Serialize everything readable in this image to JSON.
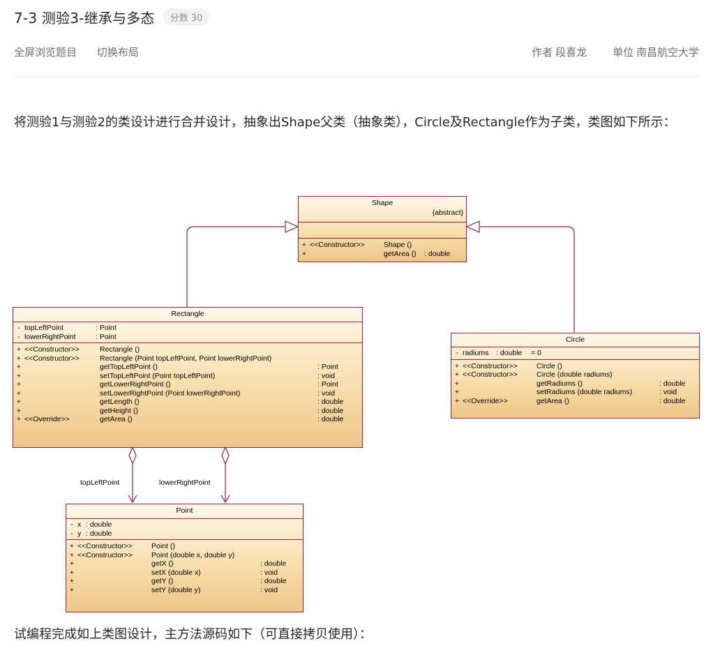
{
  "header": {
    "title": "7-3 测验3-继承与多态",
    "score": "分数 30",
    "actions": [
      "全屏浏览题目",
      "切换布局"
    ],
    "author_label": "作者",
    "author": "段喜龙",
    "unit_label": "单位",
    "unit": "南昌航空大学"
  },
  "description": "将测验1与测验2的类设计进行合并设计，抽象出Shape父类（抽象类），Circle及Rectangle作为子类，类图如下所示：",
  "footer_text": "试编程完成如上类图设计，主方法源码如下（可直接拷贝使用）：",
  "diagram": {
    "shape": {
      "name": "Shape",
      "stereotype": "{abstract}",
      "ops": [
        {
          "vis": "+",
          "st": "<<Constructor>>",
          "name": "Shape ()",
          "type": ""
        },
        {
          "vis": "+",
          "st": "",
          "name": "getArea ()",
          "type": ": double"
        }
      ]
    },
    "rectangle": {
      "name": "Rectangle",
      "attrs": [
        {
          "vis": "-",
          "name": "topLeftPoint",
          "type": ": Point"
        },
        {
          "vis": "-",
          "name": "lowerRightPoint",
          "type": ": Point"
        }
      ],
      "ops": [
        {
          "vis": "+",
          "st": "<<Constructor>>",
          "name": "Rectangle ()",
          "type": ""
        },
        {
          "vis": "+",
          "st": "<<Constructor>>",
          "name": "Rectangle (Point topLeftPoint, Point lowerRightPoint)",
          "type": ""
        },
        {
          "vis": "+",
          "st": "",
          "name": "getTopLeftPoint ()",
          "type": ": Point"
        },
        {
          "vis": "+",
          "st": "",
          "name": "setTopLeftPoint (Point topLeftPoint)",
          "type": ": void"
        },
        {
          "vis": "+",
          "st": "",
          "name": "getLowerRightPoint ()",
          "type": ": Point"
        },
        {
          "vis": "+",
          "st": "",
          "name": "setLowerRightPoint (Point lowerRightPoint)",
          "type": ": void"
        },
        {
          "vis": "+",
          "st": "",
          "name": "getLength ()",
          "type": ": double"
        },
        {
          "vis": "+",
          "st": "",
          "name": "getHeight ()",
          "type": ": double"
        },
        {
          "vis": "+",
          "st": "<<Override>>",
          "name": "getArea ()",
          "type": ": double"
        }
      ]
    },
    "circle": {
      "name": "Circle",
      "attrs": [
        {
          "vis": "-",
          "name": "radiums",
          "type": ": double",
          "init": "= 0"
        }
      ],
      "ops": [
        {
          "vis": "+",
          "st": "<<Constructor>>",
          "name": "Circle ()",
          "type": ""
        },
        {
          "vis": "+",
          "st": "<<Constructor>>",
          "name": "Circle (double radiums)",
          "type": ""
        },
        {
          "vis": "+",
          "st": "",
          "name": "getRadiums ()",
          "type": ": double"
        },
        {
          "vis": "+",
          "st": "",
          "name": "setRadiums (double radiums)",
          "type": ": void"
        },
        {
          "vis": "+",
          "st": "<<Override>>",
          "name": "getArea ()",
          "type": ": double"
        }
      ]
    },
    "point": {
      "name": "Point",
      "attrs": [
        {
          "vis": "-",
          "name": "x",
          "type": ": double"
        },
        {
          "vis": "-",
          "name": "y",
          "type": ": double"
        }
      ],
      "ops": [
        {
          "vis": "+",
          "st": "<<Constructor>>",
          "name": "Point ()",
          "type": ""
        },
        {
          "vis": "+",
          "st": "<<Constructor>>",
          "name": "Point (double x, double y)",
          "type": ""
        },
        {
          "vis": "+",
          "st": "",
          "name": "getX ()",
          "type": ": double"
        },
        {
          "vis": "+",
          "st": "",
          "name": "setX (double x)",
          "type": ": void"
        },
        {
          "vis": "+",
          "st": "",
          "name": "getY ()",
          "type": ": double"
        },
        {
          "vis": "+",
          "st": "",
          "name": "setY (double y)",
          "type": ": void"
        }
      ]
    },
    "assoc_labels": [
      "topLeftPoint",
      "lowerRightPoint"
    ]
  }
}
